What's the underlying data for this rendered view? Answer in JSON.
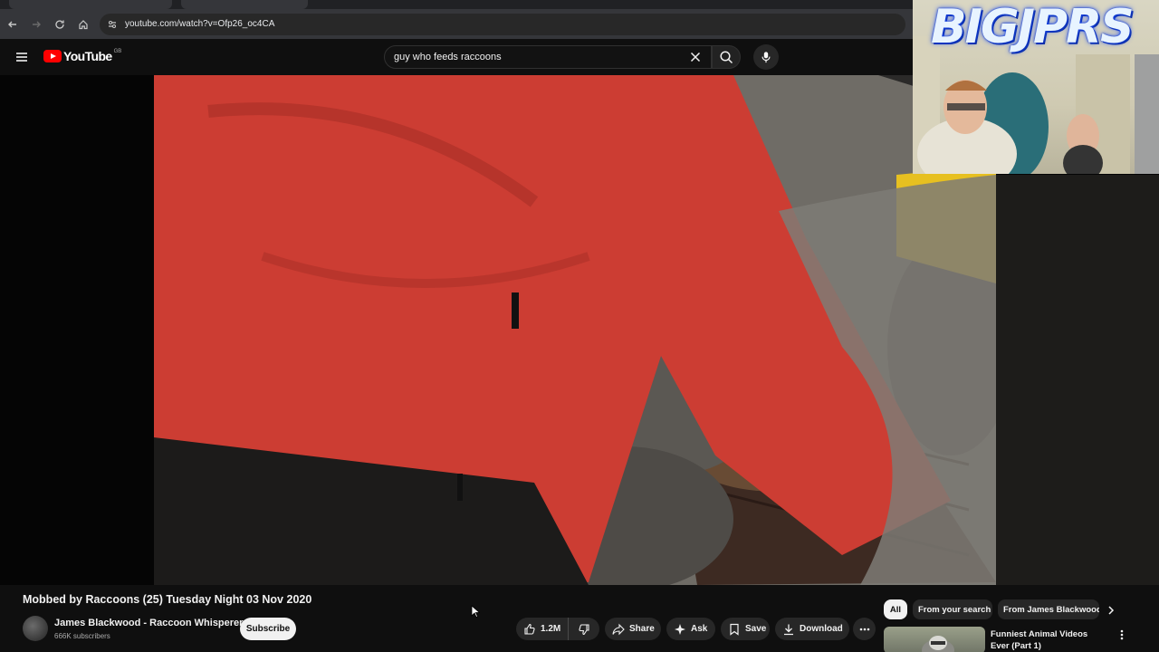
{
  "browser": {
    "url": "youtube.com/watch?v=Ofp26_oc4CA"
  },
  "header": {
    "logo_text": "YouTube",
    "region": "GB",
    "search_value": "guy who feeds raccoons"
  },
  "overlay": {
    "badge_text": "BIGJPRS"
  },
  "video": {
    "title": "Mobbed by Raccoons (25) Tuesday Night 03 Nov 2020",
    "channel_name": "James Blackwood - Raccoon Whisperer",
    "subscribers": "666K subscribers",
    "subscribe_label": "Subscribe",
    "likes": "1.2M",
    "share_label": "Share",
    "ask_label": "Ask",
    "save_label": "Save",
    "download_label": "Download"
  },
  "filters": {
    "chips": [
      "All",
      "From your search",
      "From James Blackwood"
    ]
  },
  "recommended": {
    "title": "Funniest Animal Videos Ever (Part 1)"
  },
  "colors": {
    "background": "#0f0f0f",
    "youtube_red": "#ff0000",
    "pill": "#272727"
  }
}
